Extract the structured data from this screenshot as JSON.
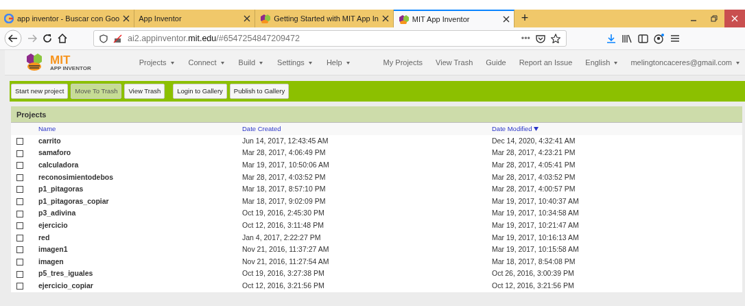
{
  "browser": {
    "tabs": [
      {
        "title": "app inventor - Buscar con Goo",
        "kind": "search",
        "selected": false
      },
      {
        "title": "App Inventor",
        "kind": "plain",
        "selected": false
      },
      {
        "title": "Getting Started with MIT App In",
        "kind": "app",
        "selected": false
      },
      {
        "title": "MIT App Inventor",
        "kind": "app",
        "selected": true
      }
    ],
    "new_tab": "+",
    "address": {
      "prefix": "ai2.appinventor.",
      "domain": "mit.edu",
      "suffix": "/#6547254847209472"
    },
    "page_actions": "•••"
  },
  "header": {
    "logo_title": "MIT",
    "logo_subtitle": "APP INVENTOR",
    "menus": [
      {
        "label": "Projects",
        "dropdown": true
      },
      {
        "label": "Connect",
        "dropdown": true
      },
      {
        "label": "Build",
        "dropdown": true
      },
      {
        "label": "Settings",
        "dropdown": true
      },
      {
        "label": "Help",
        "dropdown": true
      }
    ],
    "links": [
      {
        "label": "My Projects",
        "dropdown": false
      },
      {
        "label": "View Trash",
        "dropdown": false
      },
      {
        "label": "Guide",
        "dropdown": false
      },
      {
        "label": "Report an Issue",
        "dropdown": false
      },
      {
        "label": "English",
        "dropdown": true
      },
      {
        "label": "melingtoncaceres@gmail.com",
        "dropdown": true
      }
    ]
  },
  "toolbar": [
    {
      "label": "Start new project",
      "disabled": false
    },
    {
      "label": "Move To Trash",
      "disabled": true
    },
    {
      "label": "View Trash",
      "disabled": false
    },
    {
      "label": "Login to Gallery",
      "disabled": false,
      "gap": true
    },
    {
      "label": "Publish to Gallery",
      "disabled": false
    }
  ],
  "projects": {
    "title": "Projects",
    "columns": [
      {
        "label": "Name",
        "sorted": false
      },
      {
        "label": "Date Created",
        "sorted": false
      },
      {
        "label": "Date Modified",
        "sorted": true
      }
    ],
    "rows": [
      {
        "checked": false,
        "name": "carrito",
        "created": "Jun 14, 2017, 12:43:45 AM",
        "modified": "Dec 14, 2020, 4:32:41 AM"
      },
      {
        "checked": false,
        "name": "samaforo",
        "created": "Mar 28, 2017, 4:06:49 PM",
        "modified": "Mar 28, 2017, 4:23:21 PM"
      },
      {
        "checked": false,
        "name": "calculadora",
        "created": "Mar 19, 2017, 10:50:06 AM",
        "modified": "Mar 28, 2017, 4:05:41 PM"
      },
      {
        "checked": false,
        "name": "reconosimientodebos",
        "created": "Mar 28, 2017, 4:03:52 PM",
        "modified": "Mar 28, 2017, 4:03:52 PM"
      },
      {
        "checked": false,
        "name": "p1_pitagoras",
        "created": "Mar 18, 2017, 8:57:10 PM",
        "modified": "Mar 28, 2017, 4:00:57 PM"
      },
      {
        "checked": false,
        "name": "p1_pitagoras_copiar",
        "created": "Mar 18, 2017, 9:02:09 PM",
        "modified": "Mar 19, 2017, 10:40:37 AM"
      },
      {
        "checked": false,
        "name": "p3_adivina",
        "created": "Oct 19, 2016, 2:45:30 PM",
        "modified": "Mar 19, 2017, 10:34:58 AM"
      },
      {
        "checked": false,
        "name": "ejercicio",
        "created": "Oct 12, 2016, 3:11:48 PM",
        "modified": "Mar 19, 2017, 10:21:47 AM"
      },
      {
        "checked": false,
        "name": "red",
        "created": "Jan 4, 2017, 2:22:27 PM",
        "modified": "Mar 19, 2017, 10:16:13 AM"
      },
      {
        "checked": false,
        "name": "imagen1",
        "created": "Nov 21, 2016, 11:37:27 AM",
        "modified": "Mar 19, 2017, 10:15:58 AM"
      },
      {
        "checked": false,
        "name": "imagen",
        "created": "Nov 21, 2016, 11:27:54 AM",
        "modified": "Mar 18, 2017, 8:54:08 PM"
      },
      {
        "checked": false,
        "name": "p5_tres_iguales",
        "created": "Oct 19, 2016, 3:27:38 PM",
        "modified": "Oct 26, 2016, 3:00:39 PM"
      },
      {
        "checked": false,
        "name": "ejercicio_copiar",
        "created": "Oct 12, 2016, 3:21:56 PM",
        "modified": "Oct 12, 2016, 3:21:56 PM"
      }
    ]
  }
}
